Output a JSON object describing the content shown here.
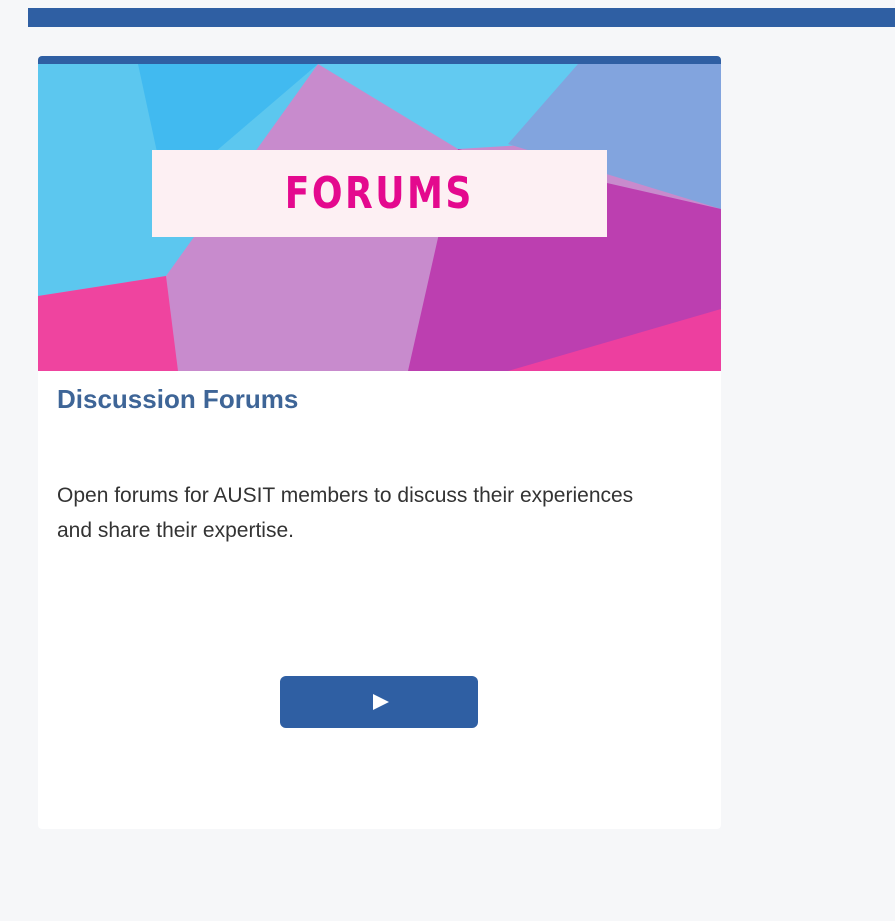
{
  "card": {
    "banner_text": "FORUMS",
    "title": "Discussion Forums",
    "description": "Open forums for AUSIT members to discuss their experiences and share their expertise.",
    "button_icon": "play-icon"
  },
  "colors": {
    "brand_blue": "#2f5fa3",
    "title_blue": "#3e6597",
    "banner_text_pink": "#e4098e",
    "page_background": "#f6f7f9"
  }
}
